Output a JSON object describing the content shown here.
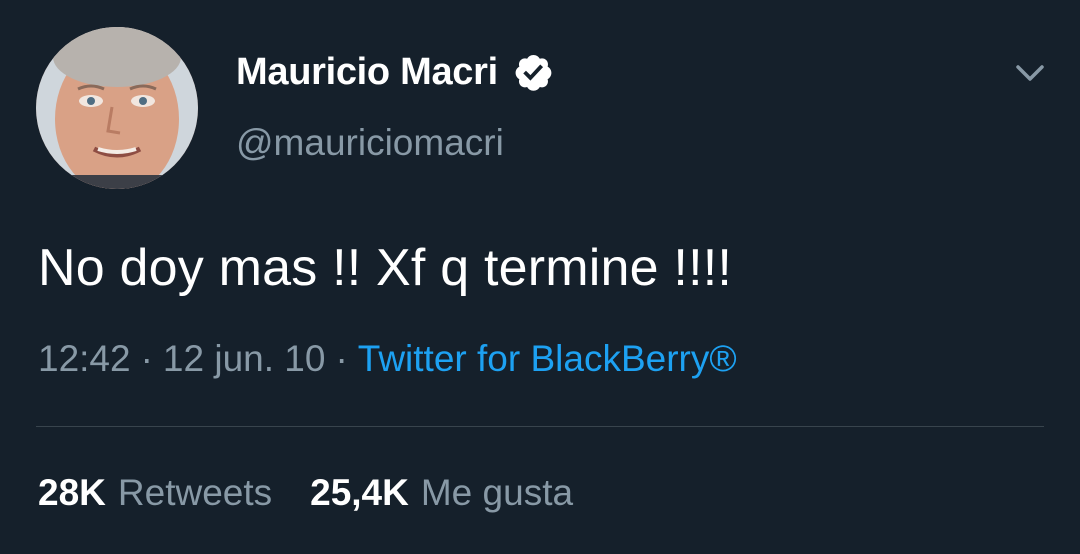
{
  "author": {
    "display_name": "Mauricio Macri",
    "handle": "@mauriciomacri",
    "verified": true,
    "verified_icon": "verified-badge-icon"
  },
  "menu_icon": "chevron-down-icon",
  "tweet": {
    "text": "No doy mas !! Xf q termine !!!!",
    "time": "12:42",
    "date": "12 jun. 10",
    "separator": "·",
    "source": "Twitter for BlackBerry®"
  },
  "stats": {
    "retweets_count": "28K",
    "retweets_label": "Retweets",
    "likes_count": "25,4K",
    "likes_label": "Me gusta"
  },
  "colors": {
    "background": "#15202b",
    "primary_text": "#ffffff",
    "secondary_text": "#8899a6",
    "link": "#1da1f2",
    "divider": "#38444d"
  }
}
